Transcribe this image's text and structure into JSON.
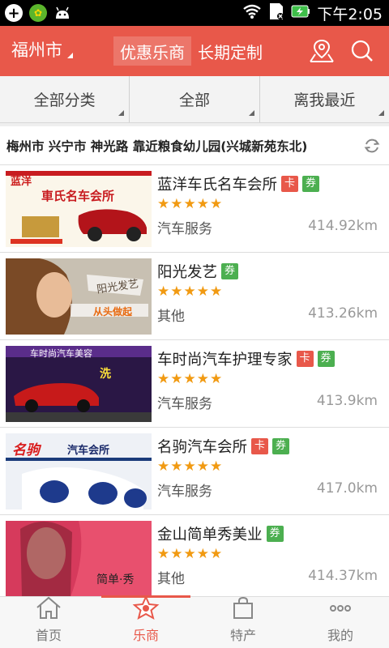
{
  "status_bar": {
    "time": "下午2:05",
    "icons": [
      "add-circle-icon",
      "clover-icon",
      "android-icon",
      "wifi-icon",
      "sd-card-icon",
      "battery-charging-icon"
    ]
  },
  "header": {
    "city": "福州市",
    "tabs": [
      {
        "label": "优惠乐商",
        "active": true
      },
      {
        "label": "长期定制",
        "active": false
      }
    ],
    "accent_color": "#e8584a"
  },
  "filters": [
    {
      "label": "全部分类"
    },
    {
      "label": "全部"
    },
    {
      "label": "离我最近"
    }
  ],
  "location": {
    "text": "梅州市 兴宁市 神光路 靠近粮食幼儿园(兴城新苑东北)"
  },
  "merchants": [
    {
      "name": "蓝洋车氏名车会所",
      "badges": [
        "卡",
        "券"
      ],
      "rating": 5,
      "stars": "★★★★★",
      "category": "汽车服务",
      "distance": "414.92km",
      "thumb_text": "車氏名车会所",
      "thumb_brand": "蓝洋"
    },
    {
      "name": "阳光发艺",
      "badges": [
        "券"
      ],
      "rating": 5,
      "stars": "★★★★★",
      "category": "其他",
      "distance": "413.26km",
      "thumb_text": "阳光发艺",
      "thumb_brand": "从头做起"
    },
    {
      "name": "车时尚汽车护理专家",
      "badges": [
        "卡",
        "券"
      ],
      "rating": 5,
      "stars": "★★★★★",
      "category": "汽车服务",
      "distance": "413.9km",
      "thumb_text": "车时尚汽车美容",
      "thumb_brand": "洗"
    },
    {
      "name": "名驹汽车会所",
      "badges": [
        "卡",
        "券"
      ],
      "rating": 5,
      "stars": "★★★★★",
      "category": "汽车服务",
      "distance": "417.0km",
      "thumb_text": "汽车会所",
      "thumb_brand": "名驹"
    },
    {
      "name": "金山简单秀美业",
      "badges": [
        "券"
      ],
      "rating": 5,
      "stars": "★★★★★",
      "category": "其他",
      "distance": "414.37km",
      "thumb_text": "简单·秀",
      "thumb_brand": ""
    }
  ],
  "bottom_nav": [
    {
      "label": "首页",
      "icon": "home-icon",
      "active": false
    },
    {
      "label": "乐商",
      "icon": "star-badge-icon",
      "active": true
    },
    {
      "label": "特产",
      "icon": "shopping-bag-icon",
      "active": false
    },
    {
      "label": "我的",
      "icon": "more-dots-icon",
      "active": false
    }
  ]
}
